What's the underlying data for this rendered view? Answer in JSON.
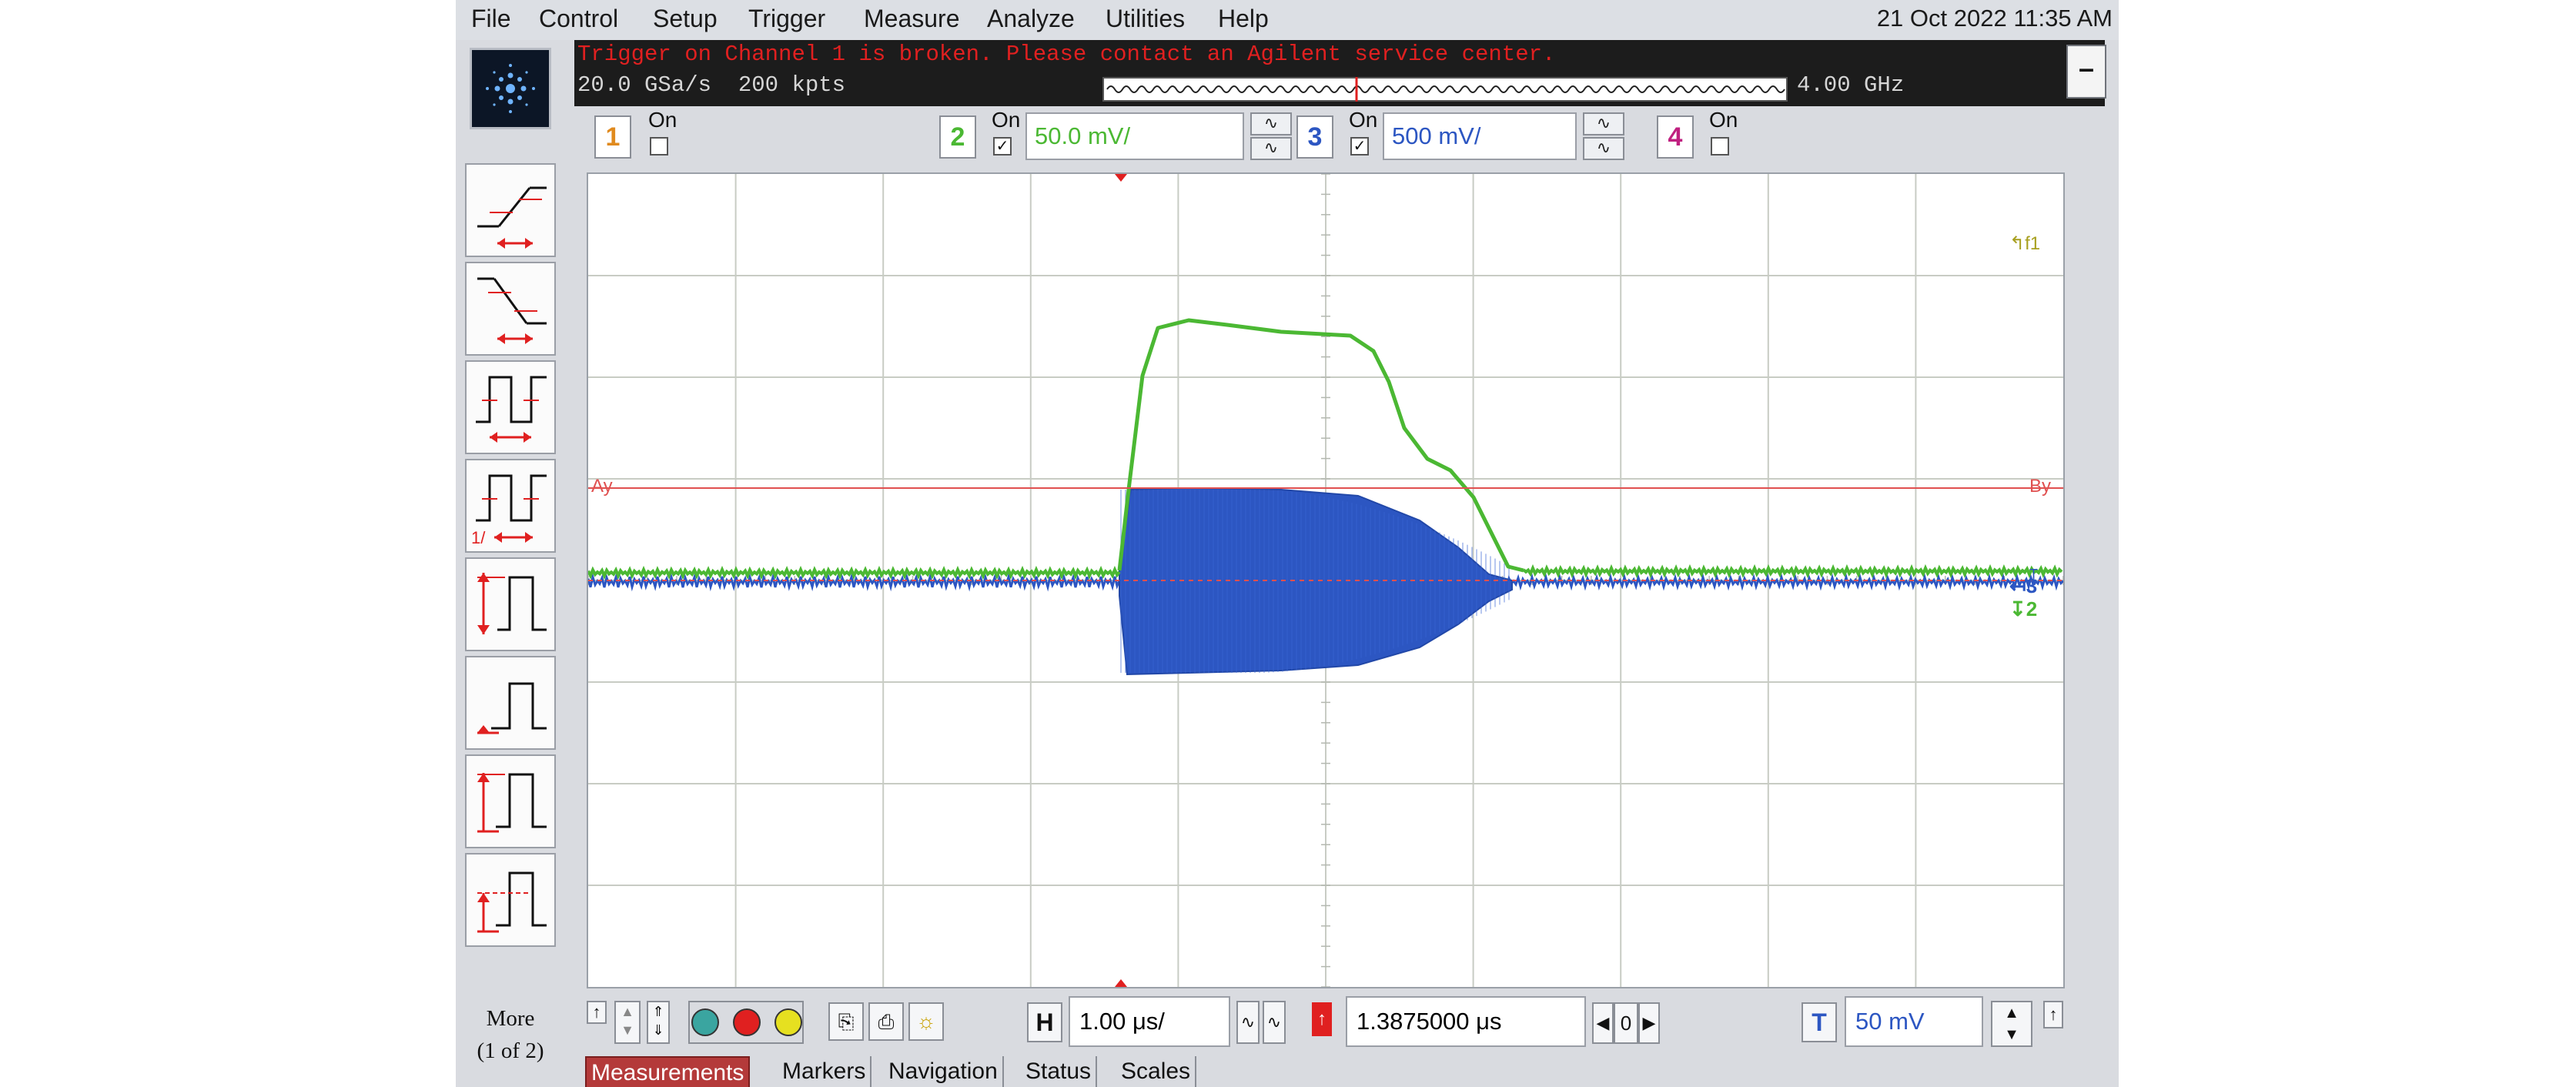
{
  "window": {
    "datetime": "21 Oct 2022 11:35 AM"
  },
  "menu": {
    "items": [
      "File",
      "Control",
      "Setup",
      "Trigger",
      "Measure",
      "Analyze",
      "Utilities",
      "Help"
    ]
  },
  "status": {
    "message": "Trigger on Channel 1 is broken.  Please contact an Agilent service center.",
    "sample_rate": "20.0 GSa/s",
    "memory_depth": "200 kpts",
    "bandwidth": "4.00 GHz"
  },
  "channels": [
    {
      "number": "1",
      "on_label": "On",
      "enabled": false,
      "color": "#e08a1e",
      "scale": ""
    },
    {
      "number": "2",
      "on_label": "On",
      "enabled": true,
      "color": "#4bb833",
      "scale": "50.0 mV/"
    },
    {
      "number": "3",
      "on_label": "On",
      "enabled": true,
      "color": "#2c56c2",
      "scale": "500 mV/"
    },
    {
      "number": "4",
      "on_label": "On",
      "enabled": false,
      "color": "#c02080",
      "scale": ""
    }
  ],
  "screen": {
    "markers": {
      "ay": "Ay",
      "by": "By"
    },
    "right_labels": {
      "f1": "f1",
      "ch3": "3",
      "ch2": "2",
      "trigger": "T"
    }
  },
  "sidebar": {
    "more_label": "More",
    "more_sub": "(1 of 2)"
  },
  "toolbar": {
    "h_label": "H",
    "timebase": "1.00 μs/",
    "delay": "1.3875000 μs",
    "delay_ref": "0",
    "t_label": "T",
    "trigger_level": "50 mV"
  },
  "tabs": [
    "Measurements",
    "Markers",
    "Navigation",
    "Status",
    "Scales"
  ],
  "colors": {
    "grid": "#c8ccc4",
    "marker": "#e05050",
    "ch2": "#4bb833",
    "ch3": "#2c56c2",
    "trigger_arrow": "#e02020"
  }
}
